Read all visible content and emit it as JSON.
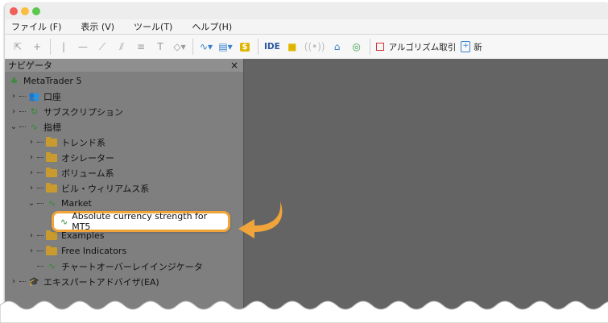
{
  "menu": [
    "ファイル (F)",
    "表示 (V)",
    "ツール(T)",
    "ヘルプ(H)"
  ],
  "toolbar": {
    "ide_label": "IDE",
    "algo_label": "アルゴリズム取引",
    "new_label": "新"
  },
  "navigator": {
    "title": "ナビゲータ",
    "close": "×",
    "root": "MetaTrader 5",
    "items": {
      "account": "口座",
      "subscription": "サブスクリプション",
      "indicators": "指標",
      "trend": "トレンド系",
      "oscillators": "オシレーター",
      "volumes": "ボリューム系",
      "bill_williams": "ビル・ウィリアムス系",
      "market": "Market",
      "examples": "Examples",
      "free_indicators": "Free Indicators",
      "chart_overlay": "チャートオーバーレイインジケータ",
      "expert_advisors": "エキスパートアドバイザ(EA)"
    },
    "highlighted_item": "Absolute currency strength for MT5"
  },
  "colors": {
    "highlight_border": "#f0a43a",
    "arrow": "#f0a43a",
    "folder": "#c99a2e",
    "chart_bg": "#646464"
  }
}
